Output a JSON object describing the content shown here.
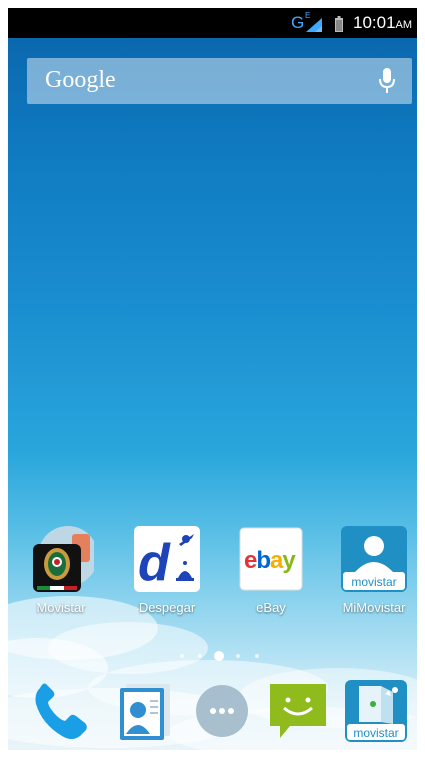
{
  "status_bar": {
    "network_type": "G",
    "network_sub": "E",
    "time": "10:01",
    "ampm": "AM"
  },
  "search": {
    "logo_text": "Google"
  },
  "apps": [
    {
      "label": "Movistar"
    },
    {
      "label": "Despegar"
    },
    {
      "label": "eBay",
      "icon_text": "ebay"
    },
    {
      "label": "MiMovistar",
      "icon_text": "movistar"
    }
  ],
  "page_indicator": {
    "count": 5,
    "active_index": 2
  },
  "dock": {
    "movistar_text": "movistar"
  },
  "colors": {
    "despegar_blue": "#1d44b8",
    "ebay_red": "#e53238",
    "ebay_blue": "#0064d2",
    "ebay_yellow": "#f5af02",
    "ebay_green": "#86b817",
    "movistar_blue": "#1f8fc4",
    "messaging_green": "#8fbc1c"
  }
}
